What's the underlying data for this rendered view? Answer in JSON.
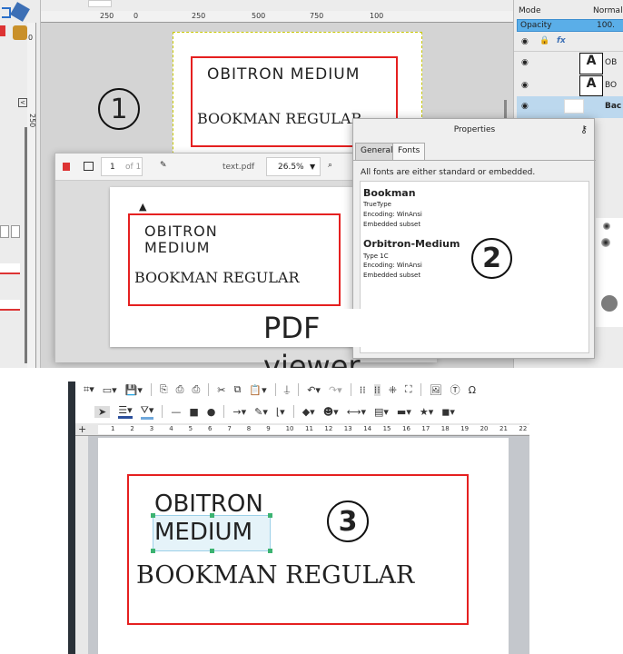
{
  "gimp": {
    "ruler_ticks": [
      "250",
      "0",
      "250",
      "500",
      "750",
      "100"
    ],
    "vruler_ticks": [
      "0",
      "250"
    ],
    "canvas_text_1": "OBITRON MEDIUM",
    "canvas_text_2": "BOOKMAN REGULAR",
    "marker": "1",
    "layers_panel": {
      "mode_label": "Mode",
      "mode_value": "Normal",
      "opacity_label": "Opacity",
      "opacity_value": "100.",
      "layers": [
        {
          "name": "OB",
          "selected": false
        },
        {
          "name": "BO",
          "selected": false
        },
        {
          "name": "Bac",
          "selected": true
        }
      ]
    }
  },
  "pdf_viewer": {
    "page_number": "1",
    "page_of": "of 1",
    "filename": "text.pdf",
    "zoom": "26.5%",
    "doc_text_1": "OBITRON MEDIUM",
    "doc_text_2": "BOOKMAN REGULAR",
    "caption": "PDF viewer"
  },
  "properties": {
    "title": "Properties",
    "tabs": [
      "General",
      "Fonts"
    ],
    "active_tab": "Fonts",
    "summary": "All fonts are either standard or embedded.",
    "fonts": [
      {
        "name": "Bookman",
        "type": "TrueType",
        "encoding": "Encoding: WinAnsi",
        "embed": "Embedded subset"
      },
      {
        "name": "Orbitron-Medium",
        "type": "Type 1C",
        "encoding": "Encoding: WinAnsi",
        "embed": "Embedded subset"
      }
    ],
    "marker": "2"
  },
  "draw": {
    "ruler_ticks": [
      "1",
      "2",
      "3",
      "4",
      "5",
      "6",
      "7",
      "8",
      "9",
      "10",
      "11",
      "12",
      "13",
      "14",
      "15",
      "16",
      "17",
      "18",
      "19",
      "20",
      "21",
      "22"
    ],
    "text_1": "OBITRON",
    "text_2": "MEDIUM",
    "text_3": "BOOKMAN REGULAR",
    "marker": "3"
  }
}
